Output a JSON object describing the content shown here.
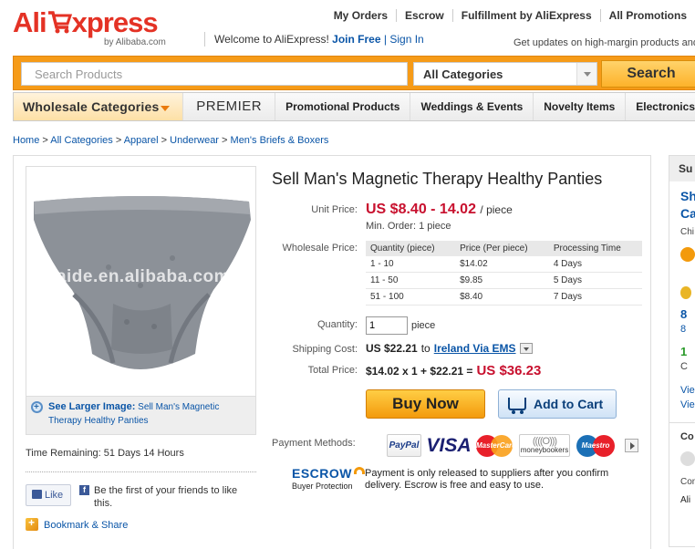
{
  "header": {
    "logo_text_1": "Ali",
    "logo_text_2": "xpress",
    "logo_sub": "by Alibaba.com",
    "topnav": [
      "My Orders",
      "Escrow",
      "Fulfillment by AliExpress",
      "All Promotions"
    ],
    "welcome": "Welcome to AliExpress!",
    "join_free": "Join Free",
    "separator": "|",
    "sign_in": "Sign In",
    "updates": "Get updates on high-margin products and"
  },
  "search": {
    "placeholder": "Search Products",
    "category": "All Categories",
    "button": "Search"
  },
  "catnav": {
    "wholesale": "Wholesale Categories",
    "premier": "PREMIER",
    "items": [
      "Promotional Products",
      "Weddings & Events",
      "Novelty Items",
      "Electronics"
    ]
  },
  "breadcrumb": [
    "Home",
    "All Categories",
    "Apparel",
    "Underwear",
    "Men's Briefs & Boxers"
  ],
  "product": {
    "title": "Sell Man's Magnetic Therapy Healthy Panties",
    "watermark": "enlaide.en.alibaba.com",
    "see_larger_label": "See Larger Image:",
    "see_larger_text": "Sell Man's Magnetic Therapy Healthy Panties",
    "time_remaining": "Time Remaining: 51 Days 14 Hours",
    "like": "Like",
    "fb_text": "Be the first of your friends to like this.",
    "bookmark": "Bookmark & Share",
    "unit_price_label": "Unit Price:",
    "unit_price": "US $8.40 - 14.02",
    "per_piece": "/ piece",
    "min_order": "Min. Order: 1 piece",
    "wholesale_label": "Wholesale Price:",
    "table_headers": [
      "Quantity (piece)",
      "Price (Per piece)",
      "Processing Time"
    ],
    "table_rows": [
      [
        "1 - 10",
        "$14.02",
        "4 Days"
      ],
      [
        "11 - 50",
        "$9.85",
        "5 Days"
      ],
      [
        "51 - 100",
        "$8.40",
        "7 Days"
      ]
    ],
    "quantity_label": "Quantity:",
    "quantity": "1",
    "quantity_unit": "piece",
    "shipping_label": "Shipping Cost:",
    "shipping_cost": "US $22.21",
    "shipping_to": "to",
    "shipping_dest": "Ireland Via EMS",
    "total_label": "Total Price:",
    "total_formula": "$14.02 x 1 + $22.21 =",
    "total": "US $36.23",
    "buy_now": "Buy Now",
    "add_to_cart": "Add to Cart",
    "payment_label": "Payment Methods:",
    "payment_methods": [
      "PayPal",
      "VISA",
      "MasterCard",
      "moneybookers",
      "Maestro"
    ],
    "escrow_logo": "ESCROW",
    "escrow_sub": "Buyer Protection",
    "escrow_text": "Payment is only released to suppliers after you confirm delivery. Escrow is free and easy to use."
  },
  "right": {
    "header": "Su",
    "line1": "Sh",
    "line2": "Ca",
    "line3": "Chi",
    "n1": "8",
    "n2": "8",
    "n3": "1",
    "c1": "C",
    "v1": "Vie",
    "v2": "Vie",
    "co": "Co",
    "com": "Con",
    "ali": "Ali"
  },
  "colors": {
    "brand_red": "#e43225",
    "search_orange": "#f69b18",
    "price_red": "#c8102e",
    "link_blue": "#0a55a7"
  }
}
